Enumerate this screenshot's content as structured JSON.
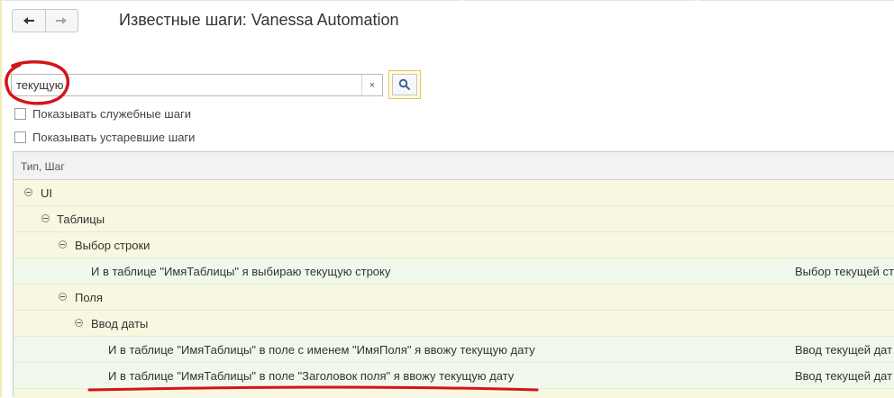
{
  "header": {
    "title": "Известные шаги: Vanessa Automation"
  },
  "search": {
    "value": "текущую",
    "clear_label": "×"
  },
  "options": {
    "show_service_steps": "Показывать служебные шаги",
    "show_obsolete_steps": "Показывать устаревшие шаги"
  },
  "grid": {
    "column_header": "Тип, Шаг",
    "rows": [
      {
        "text": "UI",
        "desc": ""
      },
      {
        "text": "Таблицы",
        "desc": ""
      },
      {
        "text": "Выбор строки",
        "desc": ""
      },
      {
        "text": "И в таблице \"ИмяТаблицы\" я выбираю текущую строку",
        "desc": "Выбор текущей ст"
      },
      {
        "text": "Поля",
        "desc": ""
      },
      {
        "text": "Ввод даты",
        "desc": ""
      },
      {
        "text": "И в таблице \"ИмяТаблицы\" в поле с именем \"ИмяПоля\" я ввожу текущую дату",
        "desc": "Ввод текущей дат"
      },
      {
        "text": "И в таблице \"ИмяТаблицы\" в поле \"Заголовок поля\" я ввожу текущую дату",
        "desc": "Ввод текущей дат"
      }
    ]
  },
  "colors": {
    "group_row": "#f7f8df",
    "step_row": "#f0f8ec",
    "annotation": "#d4141a",
    "search_accent": "#e3c652"
  },
  "icons": {
    "back": "arrow-left-icon",
    "forward": "arrow-right-icon",
    "search": "magnifier-icon",
    "collapse": "collapse-circle-icon"
  }
}
